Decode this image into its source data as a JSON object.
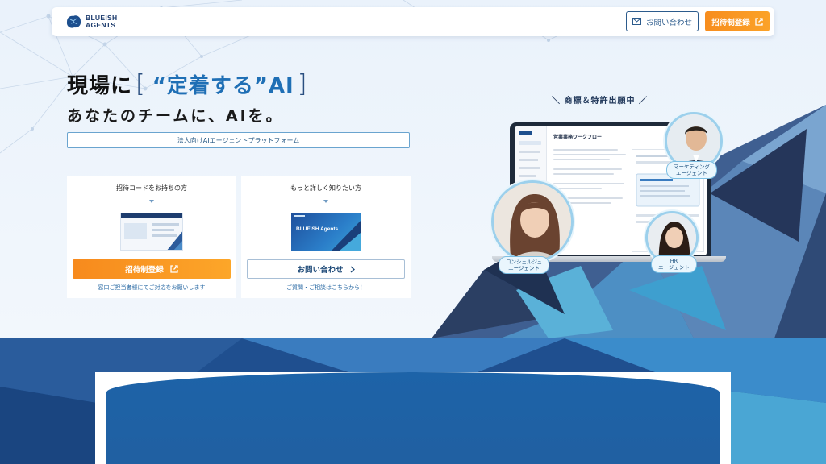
{
  "header": {
    "logo_line1": "BLUEISH",
    "logo_line2": "AGENTS",
    "contact_label": "お問い合わせ",
    "invite_label": "招待制登録"
  },
  "hero": {
    "title_prefix": "現場に",
    "title_accent": "“定着する”AI",
    "subtitle": "あなたのチームに、AIを。",
    "tagline": "法人向けAIエージェントプラットフォーム"
  },
  "cards": [
    {
      "title": "招待コードをお持ちの方",
      "button_label": "招待制登録",
      "note": "窓口ご担当者様にてご対応をお願いします"
    },
    {
      "title": "もっと詳しく知りたい方",
      "thumb_text": "BLUEISH Agents",
      "button_label": "お問い合わせ",
      "note": "ご質問・ご相談はこちらから！"
    }
  ],
  "visual": {
    "patent": "＼ 商標＆特許出願中 ／",
    "screen_title": "営業業務ワークフロー",
    "agents": [
      {
        "line1": "マーケティング",
        "line2": "エージェント"
      },
      {
        "line1": "コンシェルジュ",
        "line2": "エージェント"
      },
      {
        "line1": "HR",
        "line2": "エージェント"
      }
    ]
  },
  "colors": {
    "accent_orange": "#f78d1e",
    "brand_blue": "#1f6fb5",
    "navy": "#1d3c6e"
  }
}
